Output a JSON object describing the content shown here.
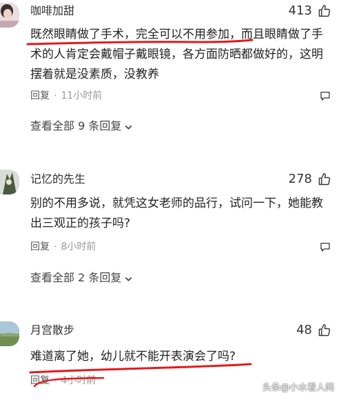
{
  "comments": [
    {
      "username": "咖啡加甜",
      "likes": "413",
      "text": "既然眼睛做了手术，完全可以不用参加，而且眼睛做了手术的人肯定会戴帽子戴眼镜，各方面防晒都做好的，这明摆着就是没素质，没教养",
      "reply_label": "回复",
      "time": "11小时前",
      "view_all": "查看全部 9 条回复"
    },
    {
      "username": "记忆的先生",
      "likes": "278",
      "text": "别的不用多说，就凭这女老师的品行，试问一下，她能教出三观正的孩子吗?",
      "reply_label": "回复",
      "time": "8小时前",
      "view_all": "查看全部 2 条回复"
    },
    {
      "username": "月宫散步",
      "likes": "48",
      "text": "难道离了她，幼儿就不能开表演会了吗?",
      "reply_label": "回复",
      "time": "4小时前"
    }
  ],
  "separator": "·",
  "watermark": "头条@小水看人间",
  "colors": {
    "annotation": "#e3191d",
    "meta": "#999999"
  },
  "icons": {
    "like": "thumbs-up-icon",
    "reply": "reply-bubble-icon",
    "expand": "chevron-down-icon"
  }
}
